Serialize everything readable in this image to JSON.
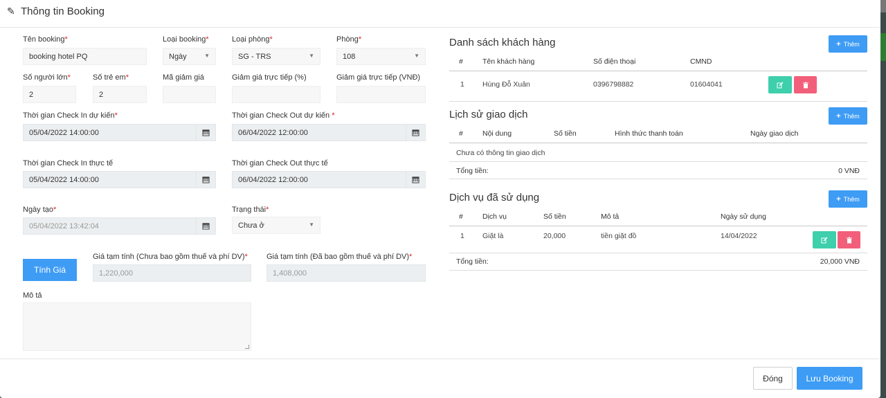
{
  "header": {
    "title": "Thông tin Booking"
  },
  "form": {
    "ten_booking": {
      "label": "Tên booking",
      "value": "booking hotel PQ"
    },
    "loai_booking": {
      "label": "Loại booking",
      "value": "Ngày"
    },
    "loai_phong": {
      "label": "Loại phòng",
      "value": "SG - TRS"
    },
    "phong": {
      "label": "Phòng",
      "value": "108"
    },
    "so_nguoi_lon": {
      "label": "Số người lớn",
      "value": "2"
    },
    "so_tre_em": {
      "label": "Số trẻ em",
      "value": "2"
    },
    "ma_giam_gia": {
      "label": "Mã giảm giá",
      "value": ""
    },
    "giam_gia_pct": {
      "label": "Giảm giá trực tiếp (%)",
      "value": ""
    },
    "giam_gia_vnd": {
      "label": "Giảm giá trực tiếp (VNĐ)",
      "value": ""
    },
    "checkin_du_kien": {
      "label": "Thời gian Check In dự kiến",
      "value": "05/04/2022 14:00:00"
    },
    "checkout_du_kien": {
      "label": "Thời gian Check Out dự kiến ",
      "value": "06/04/2022 12:00:00"
    },
    "checkin_thuc_te": {
      "label": "Thời gian Check In thực tế",
      "value": "05/04/2022 14:00:00"
    },
    "checkout_thuc_te": {
      "label": "Thời gian Check Out thực tế",
      "value": "06/04/2022 12:00:00"
    },
    "ngay_tao": {
      "label": "Ngày tạo",
      "value": "05/04/2022 13:42:04"
    },
    "trang_thai": {
      "label": "Trạng thái",
      "value": "Chưa ở"
    },
    "tinh_gia_label": "Tính Giá",
    "gia_chua_thue": {
      "label": "Giá tạm tính (Chưa bao gồm thuế và phí DV)",
      "value": "1,220,000"
    },
    "gia_da_thue": {
      "label": "Giá tạm tính (Đã bao gồm thuế và phí DV)",
      "value": "1,408,000"
    },
    "mo_ta": {
      "label": "Mô tả",
      "value": ""
    },
    "required_mark": "*"
  },
  "customers": {
    "title": "Danh sách khách hàng",
    "add_label": "Thêm",
    "columns": [
      "#",
      "Tên khách hàng",
      "Số điện thoại",
      "CMND"
    ],
    "rows": [
      {
        "no": "1",
        "name": "Hùng Đỗ Xuân",
        "phone": "0396798882",
        "id_card": "01604041"
      }
    ]
  },
  "transactions": {
    "title": "Lịch sử giao dịch",
    "add_label": "Thêm",
    "columns": [
      "#",
      "Nội dung",
      "Số tiền",
      "Hình thức thanh toán",
      "Ngày giao dịch"
    ],
    "empty_text": "Chưa có thông tin giao dịch",
    "total_label": "Tổng tiền:",
    "total_value": "0 VNĐ"
  },
  "services": {
    "title": "Dịch vụ đã sử dụng",
    "add_label": "Thêm",
    "columns": [
      "#",
      "Dịch vụ",
      "Số tiền",
      "Mô tả",
      "Ngày sử dụng"
    ],
    "rows": [
      {
        "no": "1",
        "service": "Giặt là",
        "amount": "20,000",
        "desc": "tiền giặt đồ",
        "date": "14/04/2022"
      }
    ],
    "total_label": "Tổng tiền:",
    "total_value": "20,000 VNĐ"
  },
  "footer": {
    "close_label": "Đóng",
    "save_label": "Lưu Booking"
  }
}
